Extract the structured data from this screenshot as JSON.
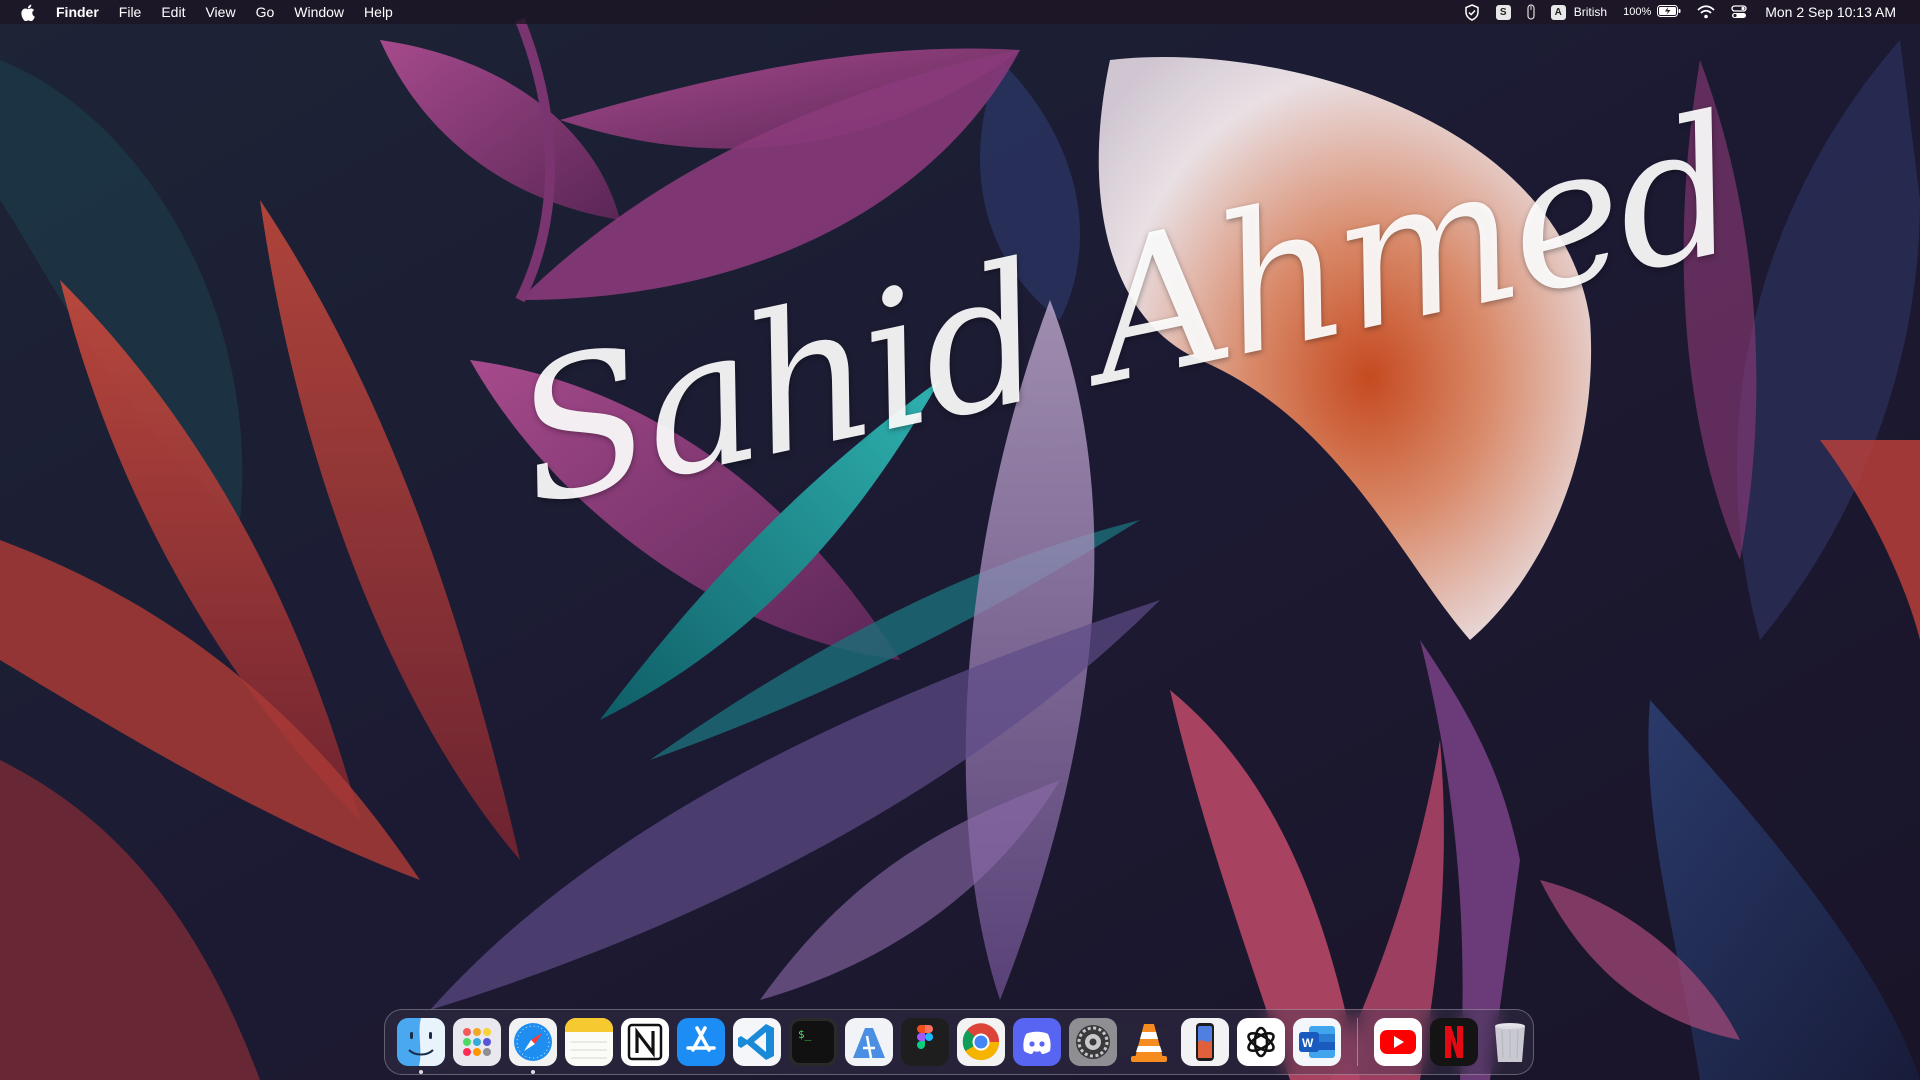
{
  "menubar": {
    "app_name": "Finder",
    "menus": [
      "File",
      "Edit",
      "View",
      "Go",
      "Window",
      "Help"
    ],
    "input_source_letter": "A",
    "input_source": "British",
    "battery_percent": "100%",
    "skype_letter": "S",
    "datetime": "Mon 2 Sep  10:13 AM"
  },
  "wallpaper": {
    "signature": "Sahid Ahmed",
    "colors": {
      "background": "#1b1930",
      "petal_red": "#c0413a",
      "petal_magenta": "#8f3a78",
      "petal_teal": "#1f8a8c",
      "lily_white": "#e9e0e4"
    }
  },
  "dock": {
    "apps": [
      {
        "name": "Finder",
        "icon": "finder-icon",
        "running": true
      },
      {
        "name": "Launchpad",
        "icon": "launchpad-icon",
        "running": false
      },
      {
        "name": "Safari",
        "icon": "safari-icon",
        "running": true
      },
      {
        "name": "Notes",
        "icon": "notes-icon",
        "running": false
      },
      {
        "name": "Notion",
        "icon": "notion-icon",
        "running": false
      },
      {
        "name": "App Store",
        "icon": "app-store-icon",
        "running": false
      },
      {
        "name": "Visual Studio Code",
        "icon": "vscode-icon",
        "running": false
      },
      {
        "name": "Terminal",
        "icon": "terminal-icon",
        "running": false
      },
      {
        "name": "Xcode Instruments",
        "icon": "instruments-icon",
        "running": false
      },
      {
        "name": "Figma",
        "icon": "figma-icon",
        "running": false
      },
      {
        "name": "Google Chrome",
        "icon": "chrome-icon",
        "running": false
      },
      {
        "name": "Discord",
        "icon": "discord-icon",
        "running": false
      },
      {
        "name": "System Settings",
        "icon": "settings-icon",
        "running": false
      },
      {
        "name": "VLC",
        "icon": "vlc-icon",
        "running": false
      },
      {
        "name": "iPhone Mirroring",
        "icon": "iphone-mirroring-icon",
        "running": false
      },
      {
        "name": "ChatGPT",
        "icon": "chatgpt-icon",
        "running": false
      },
      {
        "name": "Microsoft Word",
        "icon": "word-icon",
        "running": false
      }
    ],
    "pinned_web_apps": [
      {
        "name": "YouTube",
        "icon": "youtube-icon"
      },
      {
        "name": "Netflix",
        "icon": "netflix-icon"
      }
    ],
    "trash": {
      "name": "Trash",
      "icon": "trash-icon"
    }
  }
}
